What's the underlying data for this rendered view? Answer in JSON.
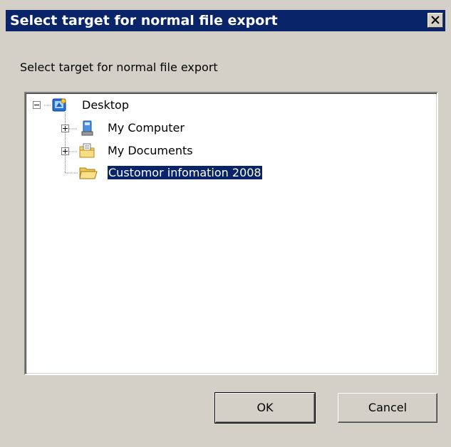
{
  "dialog": {
    "title": "Select target for normal file export",
    "prompt": "Select target for normal file export",
    "close_glyph": "✕"
  },
  "tree": {
    "root": {
      "label": "Desktop",
      "icon": "desktop-icon",
      "expanded": true
    },
    "children": [
      {
        "label": "My Computer",
        "icon": "my-computer-icon",
        "expandable": true,
        "selected": false
      },
      {
        "label": "My Documents",
        "icon": "my-documents-icon",
        "expandable": true,
        "selected": false
      },
      {
        "label": "Customor infomation 2008",
        "icon": "folder-icon",
        "expandable": false,
        "selected": true
      }
    ]
  },
  "buttons": {
    "ok_label": "OK",
    "cancel_label": "Cancel"
  },
  "colors": {
    "titlebar": "#0a246a",
    "face": "#d4d0c8",
    "selection": "#0a246a"
  }
}
